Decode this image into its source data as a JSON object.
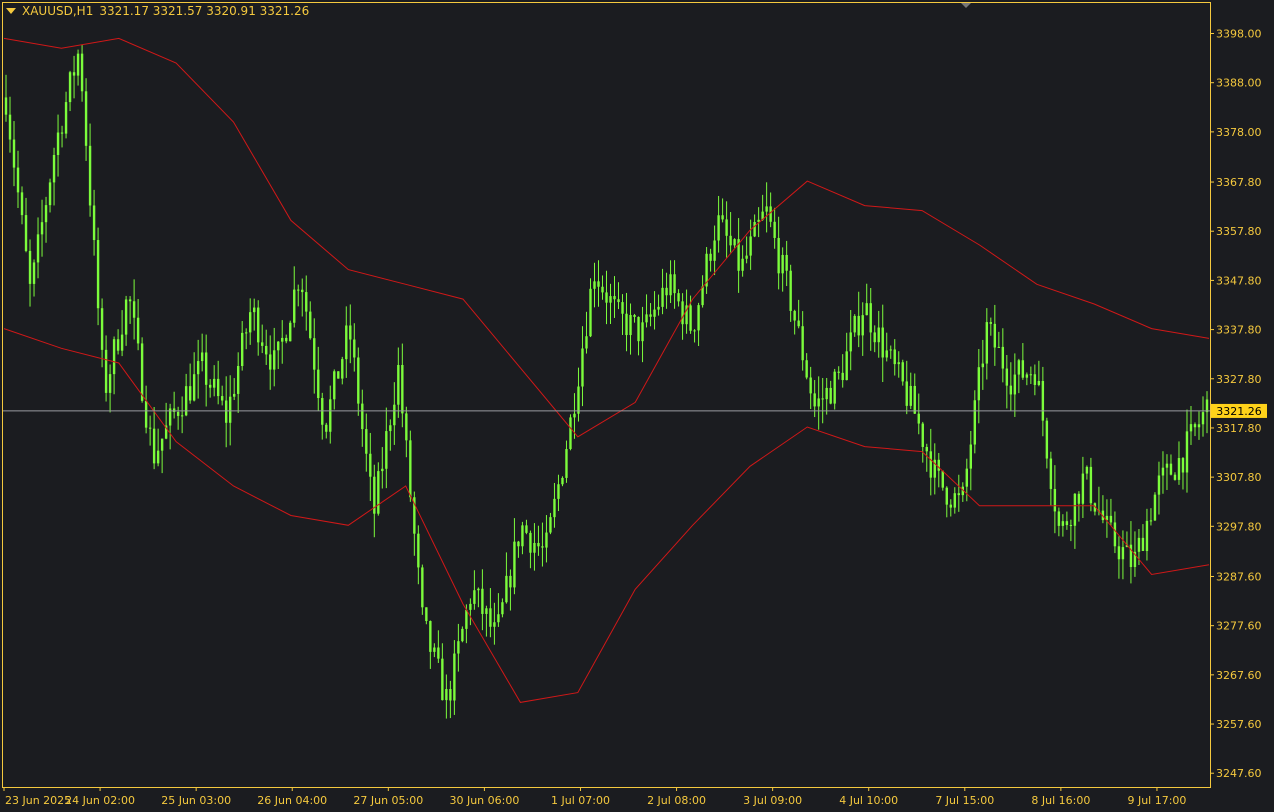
{
  "header": {
    "symbol": "XAUUSD,H1",
    "ohlc": "3321.17 3321.57 3320.91 3321.26"
  },
  "colors": {
    "background": "#1b1c20",
    "frame": "#f5c93e",
    "text": "#f5c93e",
    "candles": "#7CFC3C",
    "bands": "#d01818",
    "price_line": "#9a9aa0",
    "price_box": "#ffd21a"
  },
  "chart_data": {
    "type": "candlestick",
    "symbol": "XAUUSD",
    "timeframe": "H1",
    "ylim": [
      3245.0,
      3404.0
    ],
    "y_ticks": [
      "3398.00",
      "3388.00",
      "3378.00",
      "3367.80",
      "3357.80",
      "3347.80",
      "3337.80",
      "3327.80",
      "3317.80",
      "3307.80",
      "3297.80",
      "3287.60",
      "3277.60",
      "3267.60",
      "3257.60",
      "3247.60"
    ],
    "x_labels": [
      "23 Jun 2025",
      "24 Jun 02:00",
      "25 Jun 03:00",
      "26 Jun 04:00",
      "27 Jun 05:00",
      "30 Jun 06:00",
      "1 Jul 07:00",
      "2 Jul 08:00",
      "3 Jul 09:00",
      "4 Jul 10:00",
      "7 Jul 15:00",
      "8 Jul 16:00",
      "9 Jul 17:00"
    ],
    "bars_per_label": 24,
    "current_price": "3321.26",
    "close_path": [
      3385,
      3345,
      3375,
      3395,
      3325,
      3345,
      3312,
      3322,
      3330,
      3320,
      3342,
      3330,
      3350,
      3318,
      3338,
      3300,
      3330,
      3278,
      3262,
      3285,
      3275,
      3298,
      3292,
      3318,
      3350,
      3340,
      3337,
      3347,
      3338,
      3360,
      3350,
      3362,
      3344,
      3322,
      3328,
      3343,
      3332,
      3322,
      3307,
      3302,
      3338,
      3328,
      3330,
      3296,
      3308,
      3296,
      3290,
      3306,
      3312,
      3322
    ],
    "upper_band": [
      3397,
      3395,
      3397,
      3392,
      3380,
      3360,
      3350,
      3347,
      3344,
      3330,
      3316,
      3323,
      3344,
      3358,
      3368,
      3363,
      3362,
      3355,
      3347,
      3343,
      3338,
      3336
    ],
    "lower_band": [
      3338,
      3334,
      3331,
      3315,
      3306,
      3300,
      3298,
      3306,
      3282,
      3262,
      3264,
      3285,
      3298,
      3310,
      3318,
      3314,
      3313,
      3302,
      3302,
      3302,
      3288,
      3290
    ]
  }
}
